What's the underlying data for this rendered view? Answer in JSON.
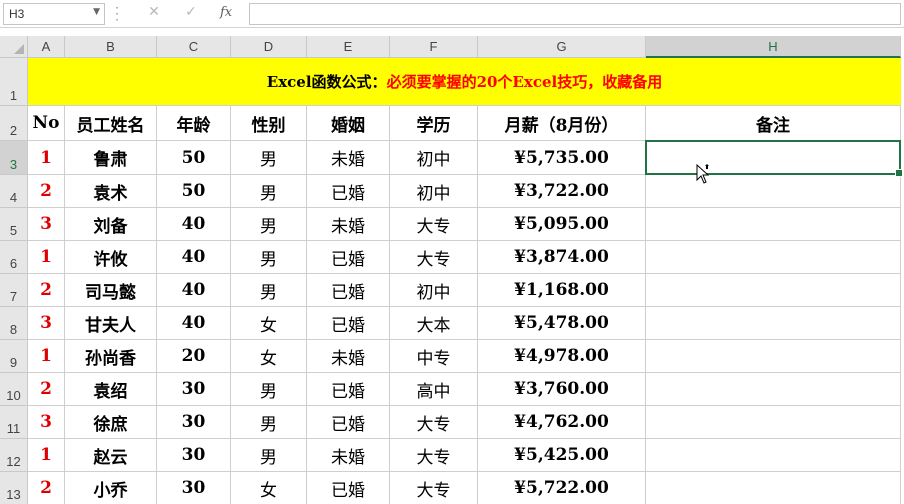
{
  "formula_bar": {
    "name_box": "H3",
    "cancel_icon": "✕",
    "enter_icon": "✓",
    "fx_label": "fx",
    "content": ""
  },
  "columns": [
    "A",
    "B",
    "C",
    "D",
    "E",
    "F",
    "G",
    "H"
  ],
  "rows": [
    "1",
    "2",
    "3",
    "4",
    "5",
    "6",
    "7",
    "8",
    "9",
    "10",
    "11",
    "12",
    "13"
  ],
  "selected_cell": "H3",
  "title": {
    "part1": "Excel函数公式：",
    "part2": "必须要掌握的20个Excel技巧，收藏备用"
  },
  "headers": [
    "No",
    "员工姓名",
    "年龄",
    "性别",
    "婚姻",
    "学历",
    "月薪（8月份）",
    "备注"
  ],
  "data": [
    [
      "1",
      "鲁肃",
      "50",
      "男",
      "未婚",
      "初中",
      "¥5,735.00",
      ""
    ],
    [
      "2",
      "袁术",
      "50",
      "男",
      "已婚",
      "初中",
      "¥3,722.00",
      ""
    ],
    [
      "3",
      "刘备",
      "40",
      "男",
      "未婚",
      "大专",
      "¥5,095.00",
      ""
    ],
    [
      "1",
      "许攸",
      "40",
      "男",
      "已婚",
      "大专",
      "¥3,874.00",
      ""
    ],
    [
      "2",
      "司马懿",
      "40",
      "男",
      "已婚",
      "初中",
      "¥1,168.00",
      ""
    ],
    [
      "3",
      "甘夫人",
      "40",
      "女",
      "已婚",
      "大本",
      "¥5,478.00",
      ""
    ],
    [
      "1",
      "孙尚香",
      "20",
      "女",
      "未婚",
      "中专",
      "¥4,978.00",
      ""
    ],
    [
      "2",
      "袁绍",
      "30",
      "男",
      "已婚",
      "高中",
      "¥3,760.00",
      ""
    ],
    [
      "3",
      "徐庶",
      "30",
      "男",
      "已婚",
      "大专",
      "¥4,762.00",
      ""
    ],
    [
      "1",
      "赵云",
      "30",
      "男",
      "未婚",
      "大专",
      "¥5,425.00",
      ""
    ],
    [
      "2",
      "小乔",
      "30",
      "女",
      "已婚",
      "大专",
      "¥5,722.00",
      ""
    ]
  ]
}
